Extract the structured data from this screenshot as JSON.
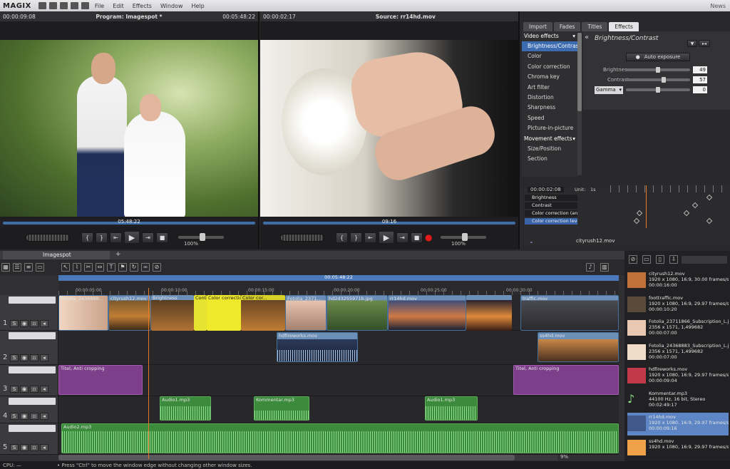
{
  "app": {
    "logo": "MAGIX",
    "menu": [
      "File",
      "Edit",
      "Effects",
      "Window",
      "Help"
    ],
    "news": "News"
  },
  "program_monitor": {
    "timecode": "00:00:09:08",
    "title": "Program: Imagespot *",
    "duration": "00:05:48:22",
    "scrub_time": "05:48:22",
    "zoom": "100%"
  },
  "source_monitor": {
    "timecode": "00:00:02:17",
    "title": "Source: rr14hd.mov",
    "scrub_time": "09:16",
    "zoom": "100%"
  },
  "right_tabs": [
    "Import",
    "Fades",
    "Titles",
    "Effects"
  ],
  "effects": {
    "video_header": "Video effects",
    "video_items": [
      "Brightness/Contrast",
      "Color",
      "Color correction",
      "Chroma key",
      "Art filter",
      "Distortion",
      "Sharpness",
      "Speed",
      "Picture-in-picture"
    ],
    "movement_header": "Movement effects",
    "movement_items": [
      "Size/Position",
      "Section"
    ],
    "panel_title": "Brightness/Contrast",
    "auto_exposure": "Auto exposure",
    "brightness_label": "Brightness",
    "brightness_value": "49",
    "contrast_label": "Contrast",
    "contrast_value": "57",
    "gamma_label": "Gamma",
    "gamma_value": "0"
  },
  "keyframes": {
    "timecode": "00:00:02:08",
    "unit": "Unit:",
    "unit_value": "1s",
    "rows": [
      "Brightness",
      "Contrast",
      "Color correction (angle)",
      "Color correction level"
    ],
    "footer_file": "cityrush12.mov"
  },
  "timeline": {
    "tab": "Imagespot",
    "center_time": "00:05:48:22",
    "ruler": [
      "00:00:05:00",
      "00:00:10:00",
      "00:00:15:00",
      "00:00:20:00",
      "00:00:25:00",
      "00:00:30:00"
    ],
    "track_numbers": [
      "1",
      "2",
      "3",
      "4",
      "5"
    ],
    "track1_clips": [
      "Fotolia_2436888...",
      "cityrush12.mov",
      "Brightness",
      "Contrast",
      "Color correction (angle)",
      "Color cor...",
      "Fotolia_2371...",
      "hd2d3255971b.jpg",
      "rr14hd.mov",
      "traffic.mov"
    ],
    "track2_clips": [
      "hdfireworks.mov",
      "ss4hd.mov"
    ],
    "track3_clips": [
      "Titel",
      "Anti cropping",
      "Titel",
      "Anti cropping"
    ],
    "track4_clips": [
      "Audio1.mp3",
      "Kommentar.mp3",
      "Audio1.mp3"
    ],
    "track5_clip": "Audio2.mp3",
    "zoom": "9%"
  },
  "media_pool": [
    {
      "name": "cityrush12.mov",
      "info": "1920 x 1080, 16:9, 30.00 frames/s",
      "dur": "00:00:16:00"
    },
    {
      "name": "foottraffic.mov",
      "info": "1920 x 1080, 16:9, 29.97 frames/s",
      "dur": "00:00:10:20"
    },
    {
      "name": "Fotolia_23711866_Subscription_L.jpg",
      "info": "2356 x 1571, 1,499682",
      "dur": "00:00:07:00"
    },
    {
      "name": "Fotolia_24368883_Subscription_L.jpg",
      "info": "2356 x 1571, 1,499682",
      "dur": "00:00:07:00"
    },
    {
      "name": "hdfireworks.mov",
      "info": "1920 x 1080, 16:9, 29.97 frames/s",
      "dur": "00:00:09:04"
    },
    {
      "name": "Kommentar.mp3",
      "info": "44100 Hz, 16 bit, Stereo",
      "dur": "00:02:49:17"
    },
    {
      "name": "rr14hd.mov",
      "info": "1920 x 1080, 16:9, 29.97 frames/s",
      "dur": "00:00:09:16"
    },
    {
      "name": "ss4hd.mov",
      "info": "1920 x 1080, 16:9, 29.97 frames/s",
      "dur": ""
    }
  ],
  "status": {
    "cpu": "CPU: —",
    "hint": "• Press \"Ctrl\" to move the window edge without changing other window sizes."
  }
}
